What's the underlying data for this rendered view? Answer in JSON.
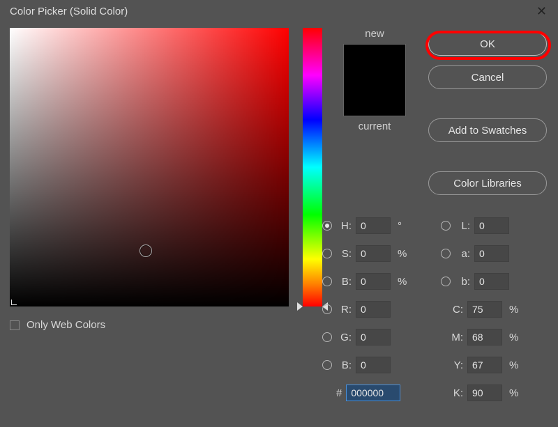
{
  "title": "Color Picker (Solid Color)",
  "labels": {
    "new": "new",
    "current": "current",
    "onlyWeb": "Only Web Colors"
  },
  "buttons": {
    "ok": "OK",
    "cancel": "Cancel",
    "add": "Add to Swatches",
    "libs": "Color Libraries"
  },
  "swatch": {
    "newColor": "#000000",
    "currentColor": "#000000"
  },
  "fields": {
    "H": {
      "label": "H:",
      "value": "0",
      "unit": "°",
      "radio": true,
      "selected": true
    },
    "S": {
      "label": "S:",
      "value": "0",
      "unit": "%",
      "radio": true,
      "selected": false
    },
    "Bv": {
      "label": "B:",
      "value": "0",
      "unit": "%",
      "radio": true,
      "selected": false
    },
    "R": {
      "label": "R:",
      "value": "0",
      "radio": true,
      "selected": false
    },
    "G": {
      "label": "G:",
      "value": "0",
      "radio": true,
      "selected": false
    },
    "Bc": {
      "label": "B:",
      "value": "0",
      "radio": true,
      "selected": false
    },
    "L": {
      "label": "L:",
      "value": "0",
      "radio": true,
      "selected": false
    },
    "a": {
      "label": "a:",
      "value": "0",
      "radio": true,
      "selected": false
    },
    "b": {
      "label": "b:",
      "value": "0",
      "radio": true,
      "selected": false
    },
    "C": {
      "label": "C:",
      "value": "75",
      "unit": "%"
    },
    "M": {
      "label": "M:",
      "value": "68",
      "unit": "%"
    },
    "Y": {
      "label": "Y:",
      "value": "67",
      "unit": "%"
    },
    "K": {
      "label": "K:",
      "value": "90",
      "unit": "%"
    }
  },
  "hex": {
    "label": "#",
    "value": "000000"
  },
  "picker": {
    "ringX": 186,
    "ringY": 311,
    "hueY": 394
  }
}
